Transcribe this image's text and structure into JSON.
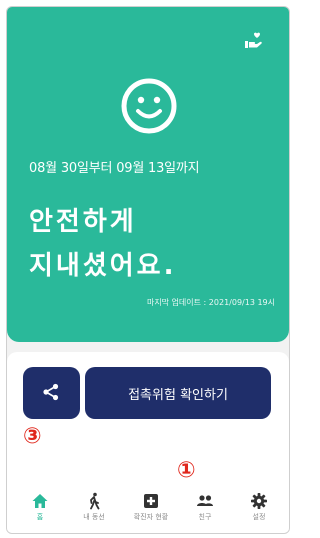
{
  "hero": {
    "date_range": "08월 30일부터 09월 13일까지",
    "status_line1": "안전하게",
    "status_line2": "지내셨어요.",
    "last_update": "마지막 업데이트 : 2021/09/13 19시",
    "icon": "heart-hand-icon",
    "face_icon": "smiley-face-icon"
  },
  "actions": {
    "share_icon": "share-icon",
    "check_label": "접촉위험 확인하기"
  },
  "markers": {
    "m3": "③",
    "m1": "①"
  },
  "nav": {
    "items": [
      {
        "label": "홈",
        "icon": "home-icon",
        "active": true
      },
      {
        "label": "내 동선",
        "icon": "walking-person-icon"
      },
      {
        "label": "확진자 현황",
        "icon": "medical-plus-icon"
      },
      {
        "label": "친구",
        "icon": "people-icon"
      },
      {
        "label": "설정",
        "icon": "gear-icon"
      }
    ]
  },
  "colors": {
    "hero_bg": "#2ab99a",
    "button_bg": "#1f2e6a",
    "marker": "#e0271c",
    "active": "#2ab99a",
    "inactive": "#8a8a8a"
  }
}
